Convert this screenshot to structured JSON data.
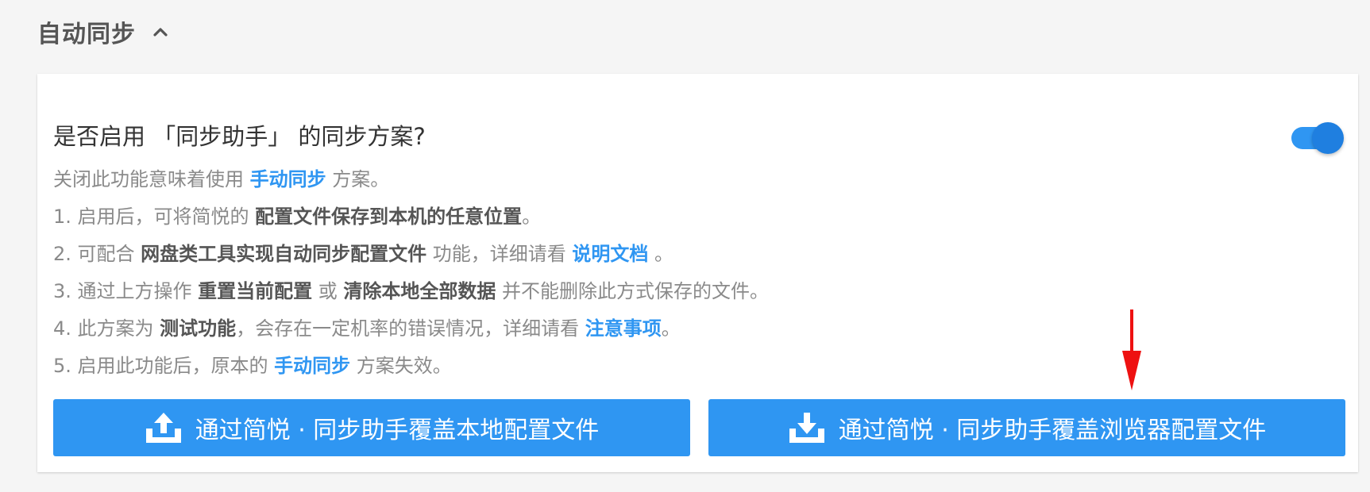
{
  "section": {
    "title": "自动同步"
  },
  "question": "是否启用 「同步助手」 的同步方案?",
  "toggle": {
    "enabled": true,
    "color": "#2f96f2"
  },
  "description": {
    "line0": {
      "pre": "关闭此功能意味着使用 ",
      "link": "手动同步",
      "post": " 方案。"
    },
    "line1": {
      "pre": "1. 启用后，可将简悦的 ",
      "bold": "配置文件保存到本机的任意位置",
      "post": "。"
    },
    "line2": {
      "pre": "2. 可配合 ",
      "bold": "网盘类工具实现自动同步配置文件",
      "mid": " 功能，详细请看 ",
      "link": "说明文档",
      "post": " 。"
    },
    "line3": {
      "pre": "3. 通过上方操作 ",
      "bold1": "重置当前配置",
      "mid": " 或 ",
      "bold2": "清除本地全部数据",
      "post": " 并不能删除此方式保存的文件。"
    },
    "line4": {
      "pre": "4. 此方案为 ",
      "bold": "测试功能",
      "mid": "，会存在一定机率的错误情况，详细请看 ",
      "link": "注意事项",
      "post": "。"
    },
    "line5": {
      "pre": "5. 启用此功能后，原本的 ",
      "link": "手动同步",
      "post": " 方案失效。"
    }
  },
  "buttons": {
    "upload_label": "通过简悦 · 同步助手覆盖本地配置文件",
    "download_label": "通过简悦 · 同步助手覆盖浏览器配置文件",
    "upload_icon": "upload-icon",
    "download_icon": "download-icon"
  },
  "colors": {
    "accent": "#2f96f2",
    "annotation_arrow": "#ee1111"
  }
}
